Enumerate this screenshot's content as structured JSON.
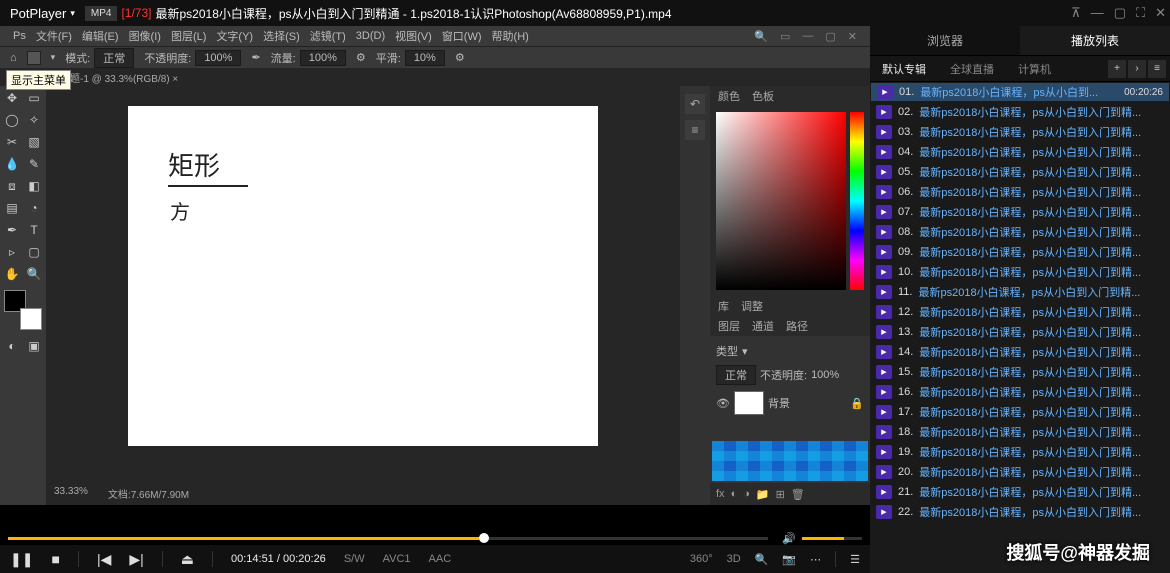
{
  "titlebar": {
    "app": "PotPlayer",
    "format": "MP4",
    "track": "[1/73]",
    "title": "最新ps2018小白课程，ps从小白到入门到精通 - 1.ps2018-1认识Photoshop(Av68808959,P1).mp4"
  },
  "tooltip": "显示主菜单",
  "ps_menu": {
    "items": [
      "文件(F)",
      "编辑(E)",
      "图像(I)",
      "图层(L)",
      "文字(Y)",
      "选择(S)",
      "滤镜(T)",
      "3D(D)",
      "视图(V)",
      "窗口(W)",
      "帮助(H)"
    ]
  },
  "optbar": {
    "mode_lbl": "模式:",
    "mode_val": "正常",
    "opacity_lbl": "不透明度:",
    "opacity_val": "100%",
    "flow_lbl": "流量:",
    "flow_val": "100%",
    "smooth_lbl": "平滑:",
    "smooth_val": "10%"
  },
  "doctab": "未标题-1 @ 33.3%(RGB/8) ×",
  "handwriting": {
    "l1": "矩形",
    "l2": "方"
  },
  "status": {
    "zoom": "33.33%",
    "size": "文档:7.66M/7.90M"
  },
  "right_panel": {
    "tab1": "颜色",
    "tab2": "色板",
    "lib1": "库",
    "lib2": "调整",
    "layers_tab1": "图层",
    "layers_tab2": "通道",
    "layers_tab3": "路径",
    "kind": "类型",
    "normal": "正常",
    "opacity_lbl": "不透明度:",
    "opacity": "100%",
    "layer_bg": "背景"
  },
  "pot": {
    "tabs": {
      "browser": "浏览器",
      "playlist": "播放列表"
    },
    "cats": {
      "default": "默认专辑",
      "live": "全球直播",
      "computer": "计算机"
    },
    "items": [
      {
        "n": "01.",
        "t": "最新ps2018小白课程，ps从小白到...",
        "d": "00:20:26",
        "sel": true
      },
      {
        "n": "02.",
        "t": "最新ps2018小白课程，ps从小白到入门到精..."
      },
      {
        "n": "03.",
        "t": "最新ps2018小白课程，ps从小白到入门到精..."
      },
      {
        "n": "04.",
        "t": "最新ps2018小白课程，ps从小白到入门到精..."
      },
      {
        "n": "05.",
        "t": "最新ps2018小白课程，ps从小白到入门到精..."
      },
      {
        "n": "06.",
        "t": "最新ps2018小白课程，ps从小白到入门到精..."
      },
      {
        "n": "07.",
        "t": "最新ps2018小白课程，ps从小白到入门到精..."
      },
      {
        "n": "08.",
        "t": "最新ps2018小白课程，ps从小白到入门到精..."
      },
      {
        "n": "09.",
        "t": "最新ps2018小白课程，ps从小白到入门到精..."
      },
      {
        "n": "10.",
        "t": "最新ps2018小白课程，ps从小白到入门到精..."
      },
      {
        "n": "11.",
        "t": "最新ps2018小白课程，ps从小白到入门到精..."
      },
      {
        "n": "12.",
        "t": "最新ps2018小白课程，ps从小白到入门到精..."
      },
      {
        "n": "13.",
        "t": "最新ps2018小白课程，ps从小白到入门到精..."
      },
      {
        "n": "14.",
        "t": "最新ps2018小白课程，ps从小白到入门到精..."
      },
      {
        "n": "15.",
        "t": "最新ps2018小白课程，ps从小白到入门到精..."
      },
      {
        "n": "16.",
        "t": "最新ps2018小白课程，ps从小白到入门到精..."
      },
      {
        "n": "17.",
        "t": "最新ps2018小白课程，ps从小白到入门到精..."
      },
      {
        "n": "18.",
        "t": "最新ps2018小白课程，ps从小白到入门到精..."
      },
      {
        "n": "19.",
        "t": "最新ps2018小白课程，ps从小白到入门到精..."
      },
      {
        "n": "20.",
        "t": "最新ps2018小白课程，ps从小白到入门到精..."
      },
      {
        "n": "21.",
        "t": "最新ps2018小白课程，ps从小白到入门到精..."
      },
      {
        "n": "22.",
        "t": "最新ps2018小白课程，ps从小白到入门到精..."
      }
    ]
  },
  "controls": {
    "time_cur": "00:14:51",
    "time_tot": "00:20:26",
    "sw": "S/W",
    "vc": "AVC1",
    "ac": "AAC",
    "r360": "360°",
    "r3d": "3D"
  },
  "watermark": "搜狐号@神器发掘"
}
